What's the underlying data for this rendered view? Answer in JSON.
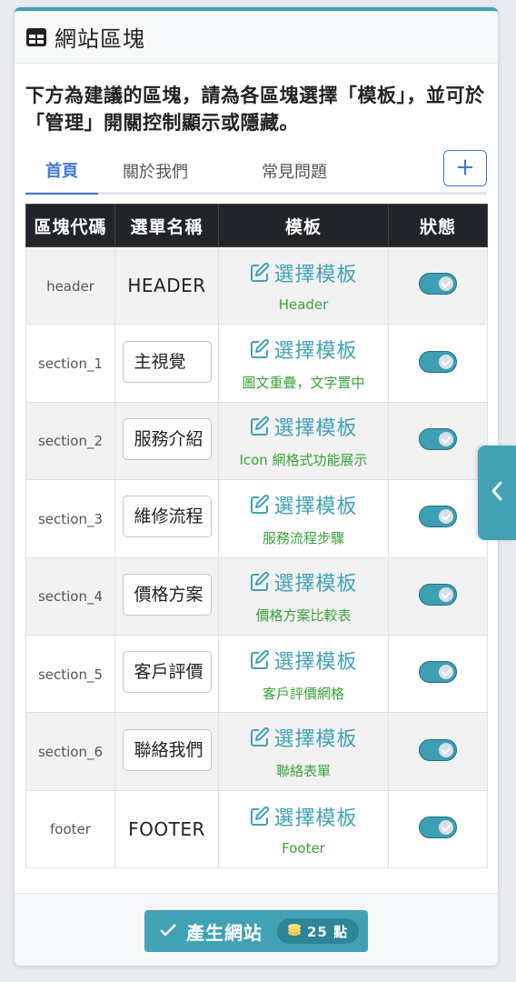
{
  "panel": {
    "title": "網站區塊",
    "intro": "下方為建議的區塊，請為各區塊選擇「模板」，並可於「管理」開關控制顯示或隱藏。"
  },
  "tabs": [
    {
      "label": "首頁",
      "active": true
    },
    {
      "label": "關於我們",
      "active": false
    },
    {
      "label": "常見問題",
      "active": false
    }
  ],
  "add_button": {
    "label": "+"
  },
  "table": {
    "headers": [
      "區塊代碼",
      "選單名稱",
      "模板",
      "狀態"
    ],
    "rows": [
      {
        "code": "header",
        "menu": "HEADER",
        "menu_editable": false,
        "action": "選擇模板",
        "template": "Header",
        "enabled": true
      },
      {
        "code": "section_1",
        "menu": "主視覺",
        "menu_editable": true,
        "action": "選擇模板",
        "template": "圖文重疊，文字置中",
        "enabled": true
      },
      {
        "code": "section_2",
        "menu": "服務介紹",
        "menu_editable": true,
        "action": "選擇模板",
        "template": "Icon 網格式功能展示",
        "enabled": true
      },
      {
        "code": "section_3",
        "menu": "維修流程",
        "menu_editable": true,
        "action": "選擇模板",
        "template": "服務流程步驟",
        "enabled": true
      },
      {
        "code": "section_4",
        "menu": "價格方案",
        "menu_editable": true,
        "action": "選擇模板",
        "template": "價格方案比較表",
        "enabled": true
      },
      {
        "code": "section_5",
        "menu": "客戶評價",
        "menu_editable": true,
        "action": "選擇模板",
        "template": "客戶評價網格",
        "enabled": true
      },
      {
        "code": "section_6",
        "menu": "聯絡我們",
        "menu_editable": true,
        "action": "選擇模板",
        "template": "聯絡表單",
        "enabled": true
      },
      {
        "code": "footer",
        "menu": "FOOTER",
        "menu_editable": false,
        "action": "選擇模板",
        "template": "Footer",
        "enabled": true
      }
    ]
  },
  "generate": {
    "label": "產生網站",
    "points": "25 點"
  },
  "colors": {
    "accent": "#41a2b6",
    "tab_active": "#3f78d6",
    "template_name": "#3aa23a",
    "table_head": "#212529"
  },
  "icons": {
    "header": "table-icon",
    "action": "edit-icon",
    "generate": "check-icon",
    "points": "coins-icon",
    "side_tab": "chevron-left-icon"
  }
}
